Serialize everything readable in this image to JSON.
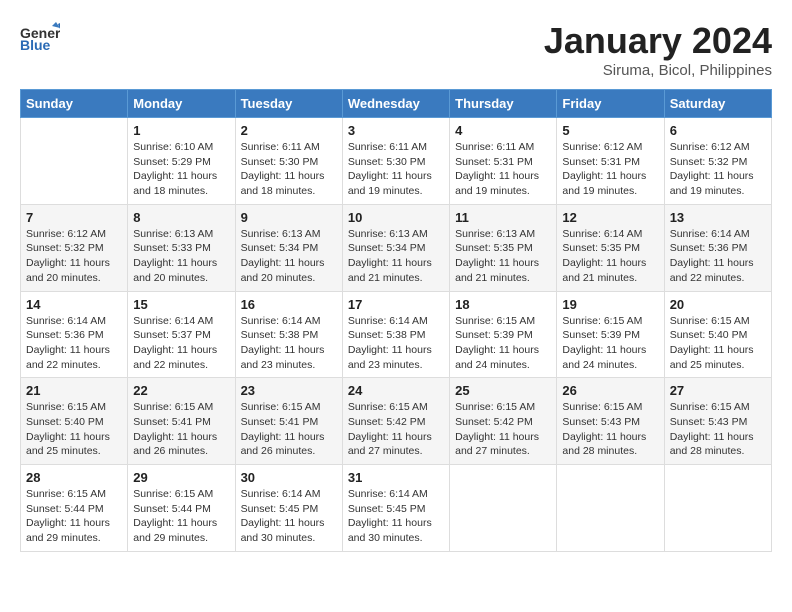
{
  "logo": {
    "text_general": "General",
    "text_blue": "Blue"
  },
  "title": "January 2024",
  "location": "Siruma, Bicol, Philippines",
  "weekdays": [
    "Sunday",
    "Monday",
    "Tuesday",
    "Wednesday",
    "Thursday",
    "Friday",
    "Saturday"
  ],
  "weeks": [
    [
      {
        "day": "",
        "sunrise": "",
        "sunset": "",
        "daylight": ""
      },
      {
        "day": "1",
        "sunrise": "Sunrise: 6:10 AM",
        "sunset": "Sunset: 5:29 PM",
        "daylight": "Daylight: 11 hours and 18 minutes."
      },
      {
        "day": "2",
        "sunrise": "Sunrise: 6:11 AM",
        "sunset": "Sunset: 5:30 PM",
        "daylight": "Daylight: 11 hours and 18 minutes."
      },
      {
        "day": "3",
        "sunrise": "Sunrise: 6:11 AM",
        "sunset": "Sunset: 5:30 PM",
        "daylight": "Daylight: 11 hours and 19 minutes."
      },
      {
        "day": "4",
        "sunrise": "Sunrise: 6:11 AM",
        "sunset": "Sunset: 5:31 PM",
        "daylight": "Daylight: 11 hours and 19 minutes."
      },
      {
        "day": "5",
        "sunrise": "Sunrise: 6:12 AM",
        "sunset": "Sunset: 5:31 PM",
        "daylight": "Daylight: 11 hours and 19 minutes."
      },
      {
        "day": "6",
        "sunrise": "Sunrise: 6:12 AM",
        "sunset": "Sunset: 5:32 PM",
        "daylight": "Daylight: 11 hours and 19 minutes."
      }
    ],
    [
      {
        "day": "7",
        "sunrise": "Sunrise: 6:12 AM",
        "sunset": "Sunset: 5:32 PM",
        "daylight": "Daylight: 11 hours and 20 minutes."
      },
      {
        "day": "8",
        "sunrise": "Sunrise: 6:13 AM",
        "sunset": "Sunset: 5:33 PM",
        "daylight": "Daylight: 11 hours and 20 minutes."
      },
      {
        "day": "9",
        "sunrise": "Sunrise: 6:13 AM",
        "sunset": "Sunset: 5:34 PM",
        "daylight": "Daylight: 11 hours and 20 minutes."
      },
      {
        "day": "10",
        "sunrise": "Sunrise: 6:13 AM",
        "sunset": "Sunset: 5:34 PM",
        "daylight": "Daylight: 11 hours and 21 minutes."
      },
      {
        "day": "11",
        "sunrise": "Sunrise: 6:13 AM",
        "sunset": "Sunset: 5:35 PM",
        "daylight": "Daylight: 11 hours and 21 minutes."
      },
      {
        "day": "12",
        "sunrise": "Sunrise: 6:14 AM",
        "sunset": "Sunset: 5:35 PM",
        "daylight": "Daylight: 11 hours and 21 minutes."
      },
      {
        "day": "13",
        "sunrise": "Sunrise: 6:14 AM",
        "sunset": "Sunset: 5:36 PM",
        "daylight": "Daylight: 11 hours and 22 minutes."
      }
    ],
    [
      {
        "day": "14",
        "sunrise": "Sunrise: 6:14 AM",
        "sunset": "Sunset: 5:36 PM",
        "daylight": "Daylight: 11 hours and 22 minutes."
      },
      {
        "day": "15",
        "sunrise": "Sunrise: 6:14 AM",
        "sunset": "Sunset: 5:37 PM",
        "daylight": "Daylight: 11 hours and 22 minutes."
      },
      {
        "day": "16",
        "sunrise": "Sunrise: 6:14 AM",
        "sunset": "Sunset: 5:38 PM",
        "daylight": "Daylight: 11 hours and 23 minutes."
      },
      {
        "day": "17",
        "sunrise": "Sunrise: 6:14 AM",
        "sunset": "Sunset: 5:38 PM",
        "daylight": "Daylight: 11 hours and 23 minutes."
      },
      {
        "day": "18",
        "sunrise": "Sunrise: 6:15 AM",
        "sunset": "Sunset: 5:39 PM",
        "daylight": "Daylight: 11 hours and 24 minutes."
      },
      {
        "day": "19",
        "sunrise": "Sunrise: 6:15 AM",
        "sunset": "Sunset: 5:39 PM",
        "daylight": "Daylight: 11 hours and 24 minutes."
      },
      {
        "day": "20",
        "sunrise": "Sunrise: 6:15 AM",
        "sunset": "Sunset: 5:40 PM",
        "daylight": "Daylight: 11 hours and 25 minutes."
      }
    ],
    [
      {
        "day": "21",
        "sunrise": "Sunrise: 6:15 AM",
        "sunset": "Sunset: 5:40 PM",
        "daylight": "Daylight: 11 hours and 25 minutes."
      },
      {
        "day": "22",
        "sunrise": "Sunrise: 6:15 AM",
        "sunset": "Sunset: 5:41 PM",
        "daylight": "Daylight: 11 hours and 26 minutes."
      },
      {
        "day": "23",
        "sunrise": "Sunrise: 6:15 AM",
        "sunset": "Sunset: 5:41 PM",
        "daylight": "Daylight: 11 hours and 26 minutes."
      },
      {
        "day": "24",
        "sunrise": "Sunrise: 6:15 AM",
        "sunset": "Sunset: 5:42 PM",
        "daylight": "Daylight: 11 hours and 27 minutes."
      },
      {
        "day": "25",
        "sunrise": "Sunrise: 6:15 AM",
        "sunset": "Sunset: 5:42 PM",
        "daylight": "Daylight: 11 hours and 27 minutes."
      },
      {
        "day": "26",
        "sunrise": "Sunrise: 6:15 AM",
        "sunset": "Sunset: 5:43 PM",
        "daylight": "Daylight: 11 hours and 28 minutes."
      },
      {
        "day": "27",
        "sunrise": "Sunrise: 6:15 AM",
        "sunset": "Sunset: 5:43 PM",
        "daylight": "Daylight: 11 hours and 28 minutes."
      }
    ],
    [
      {
        "day": "28",
        "sunrise": "Sunrise: 6:15 AM",
        "sunset": "Sunset: 5:44 PM",
        "daylight": "Daylight: 11 hours and 29 minutes."
      },
      {
        "day": "29",
        "sunrise": "Sunrise: 6:15 AM",
        "sunset": "Sunset: 5:44 PM",
        "daylight": "Daylight: 11 hours and 29 minutes."
      },
      {
        "day": "30",
        "sunrise": "Sunrise: 6:14 AM",
        "sunset": "Sunset: 5:45 PM",
        "daylight": "Daylight: 11 hours and 30 minutes."
      },
      {
        "day": "31",
        "sunrise": "Sunrise: 6:14 AM",
        "sunset": "Sunset: 5:45 PM",
        "daylight": "Daylight: 11 hours and 30 minutes."
      },
      {
        "day": "",
        "sunrise": "",
        "sunset": "",
        "daylight": ""
      },
      {
        "day": "",
        "sunrise": "",
        "sunset": "",
        "daylight": ""
      },
      {
        "day": "",
        "sunrise": "",
        "sunset": "",
        "daylight": ""
      }
    ]
  ]
}
